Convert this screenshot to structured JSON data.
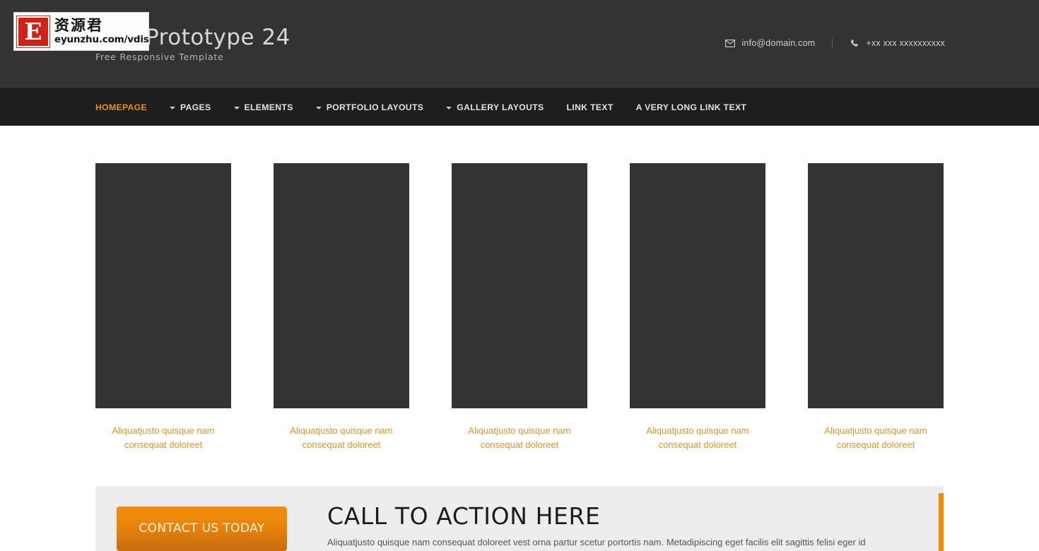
{
  "colors": {
    "header_bg": "#333333",
    "nav_bg": "#1e1e1e",
    "accent_orange": "#e88e1b",
    "cta_bg": "#ededed",
    "cta_accent": "#f08c00",
    "thumb_bg": "#333333",
    "caption_orange": "#e0931f"
  },
  "header": {
    "brand_title": "200 Prototype 24",
    "brand_subtitle": "Free Responsive Template",
    "contact": {
      "email_icon": "envelope-icon",
      "email": "info@domain.com",
      "phone_icon": "phone-icon",
      "phone": "+xx xxx xxxxxxxxxx"
    }
  },
  "nav": {
    "items": [
      {
        "label": "HOMEPAGE",
        "has_dropdown": false,
        "active": true
      },
      {
        "label": "PAGES",
        "has_dropdown": true,
        "active": false
      },
      {
        "label": "ELEMENTS",
        "has_dropdown": true,
        "active": false
      },
      {
        "label": "PORTFOLIO LAYOUTS",
        "has_dropdown": true,
        "active": false
      },
      {
        "label": "GALLERY LAYOUTS",
        "has_dropdown": true,
        "active": false
      },
      {
        "label": "LINK TEXT",
        "has_dropdown": false,
        "active": false
      },
      {
        "label": "A VERY LONG LINK TEXT",
        "has_dropdown": false,
        "active": false
      }
    ]
  },
  "gallery": {
    "items": [
      {
        "caption": "Aliquatjusto quisque nam consequat doloreet"
      },
      {
        "caption": "Aliquatjusto quisque nam consequat doloreet"
      },
      {
        "caption": "Aliquatjusto quisque nam consequat doloreet"
      },
      {
        "caption": "Aliquatjusto quisque nam consequat doloreet"
      },
      {
        "caption": "Aliquatjusto quisque nam consequat doloreet"
      }
    ]
  },
  "cta": {
    "button_label": "CONTACT US TODAY",
    "heading": "CALL TO ACTION HERE",
    "body": "Aliquatjusto quisque nam consequat doloreet vest orna partur scetur portortis nam. Metadipiscing eget facilis elit sagittis felisi eger id"
  },
  "watermark": {
    "badge_letter": "E",
    "cn_text": "资源君",
    "url": "eyunzhu.com/vdisk"
  }
}
